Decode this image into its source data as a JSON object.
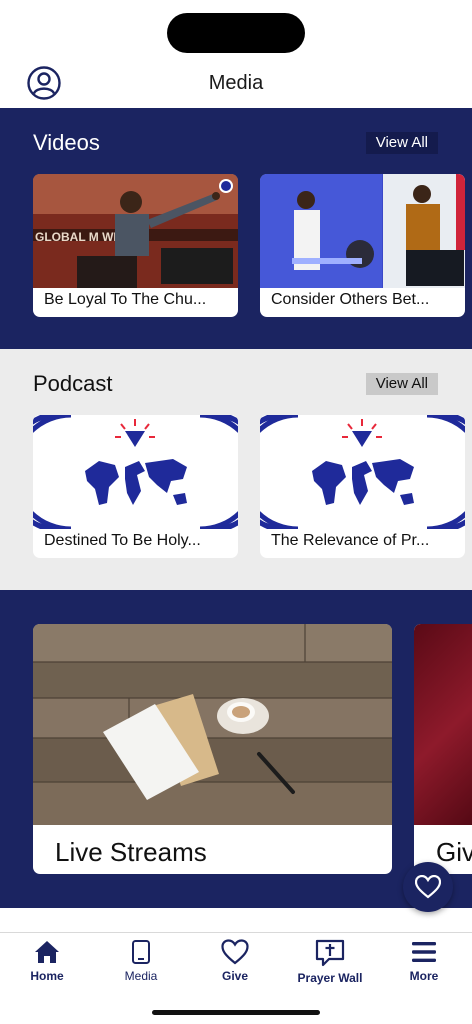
{
  "header": {
    "title": "Media"
  },
  "videos": {
    "title": "Videos",
    "view_all": "View All",
    "items": [
      {
        "caption": "Be Loyal To The Chu..."
      },
      {
        "caption": "Consider Others Bet..."
      }
    ]
  },
  "podcast": {
    "title": "Podcast",
    "view_all": "View All",
    "items": [
      {
        "caption": "Destined To Be Holy..."
      },
      {
        "caption": "The Relevance of Pr..."
      }
    ]
  },
  "featured": {
    "items": [
      {
        "caption": "Live Streams"
      },
      {
        "caption": "Giv"
      }
    ]
  },
  "tabs": [
    {
      "label": "Home",
      "icon": "home-icon"
    },
    {
      "label": "Media",
      "icon": "tablet-icon"
    },
    {
      "label": "Give",
      "icon": "heart-icon"
    },
    {
      "label": "Prayer Wall",
      "icon": "prayer-cross-icon"
    },
    {
      "label": "More",
      "icon": "menu-icon"
    }
  ],
  "colors": {
    "navy": "#1b2461",
    "podcast_bg": "#ececec",
    "logo_blue": "#1f2a9a",
    "logo_red": "#e8283a"
  }
}
